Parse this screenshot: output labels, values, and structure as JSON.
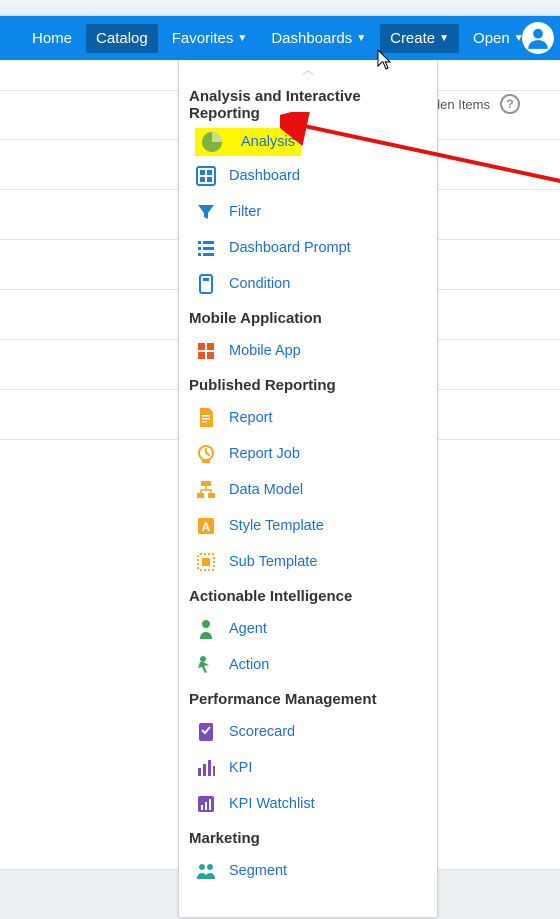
{
  "nav": {
    "home": "Home",
    "catalog": "Catalog",
    "favorites": "Favorites",
    "dashboards": "Dashboards",
    "create": "Create",
    "open": "Open"
  },
  "bg": {
    "hidden_items": "den Items"
  },
  "dropdown": {
    "sections": {
      "analysis": "Analysis and Interactive Reporting",
      "mobile": "Mobile Application",
      "published": "Published Reporting",
      "actionable": "Actionable Intelligence",
      "performance": "Performance Management",
      "marketing": "Marketing"
    },
    "items": {
      "analysis": "Analysis",
      "dashboard": "Dashboard",
      "filter": "Filter",
      "dashboard_prompt": "Dashboard Prompt",
      "condition": "Condition",
      "mobile_app": "Mobile App",
      "report": "Report",
      "report_job": "Report Job",
      "data_model": "Data Model",
      "style_template": "Style Template",
      "sub_template": "Sub Template",
      "agent": "Agent",
      "action": "Action",
      "scorecard": "Scorecard",
      "kpi": "KPI",
      "kpi_watchlist": "KPI Watchlist",
      "segment": "Segment"
    }
  }
}
